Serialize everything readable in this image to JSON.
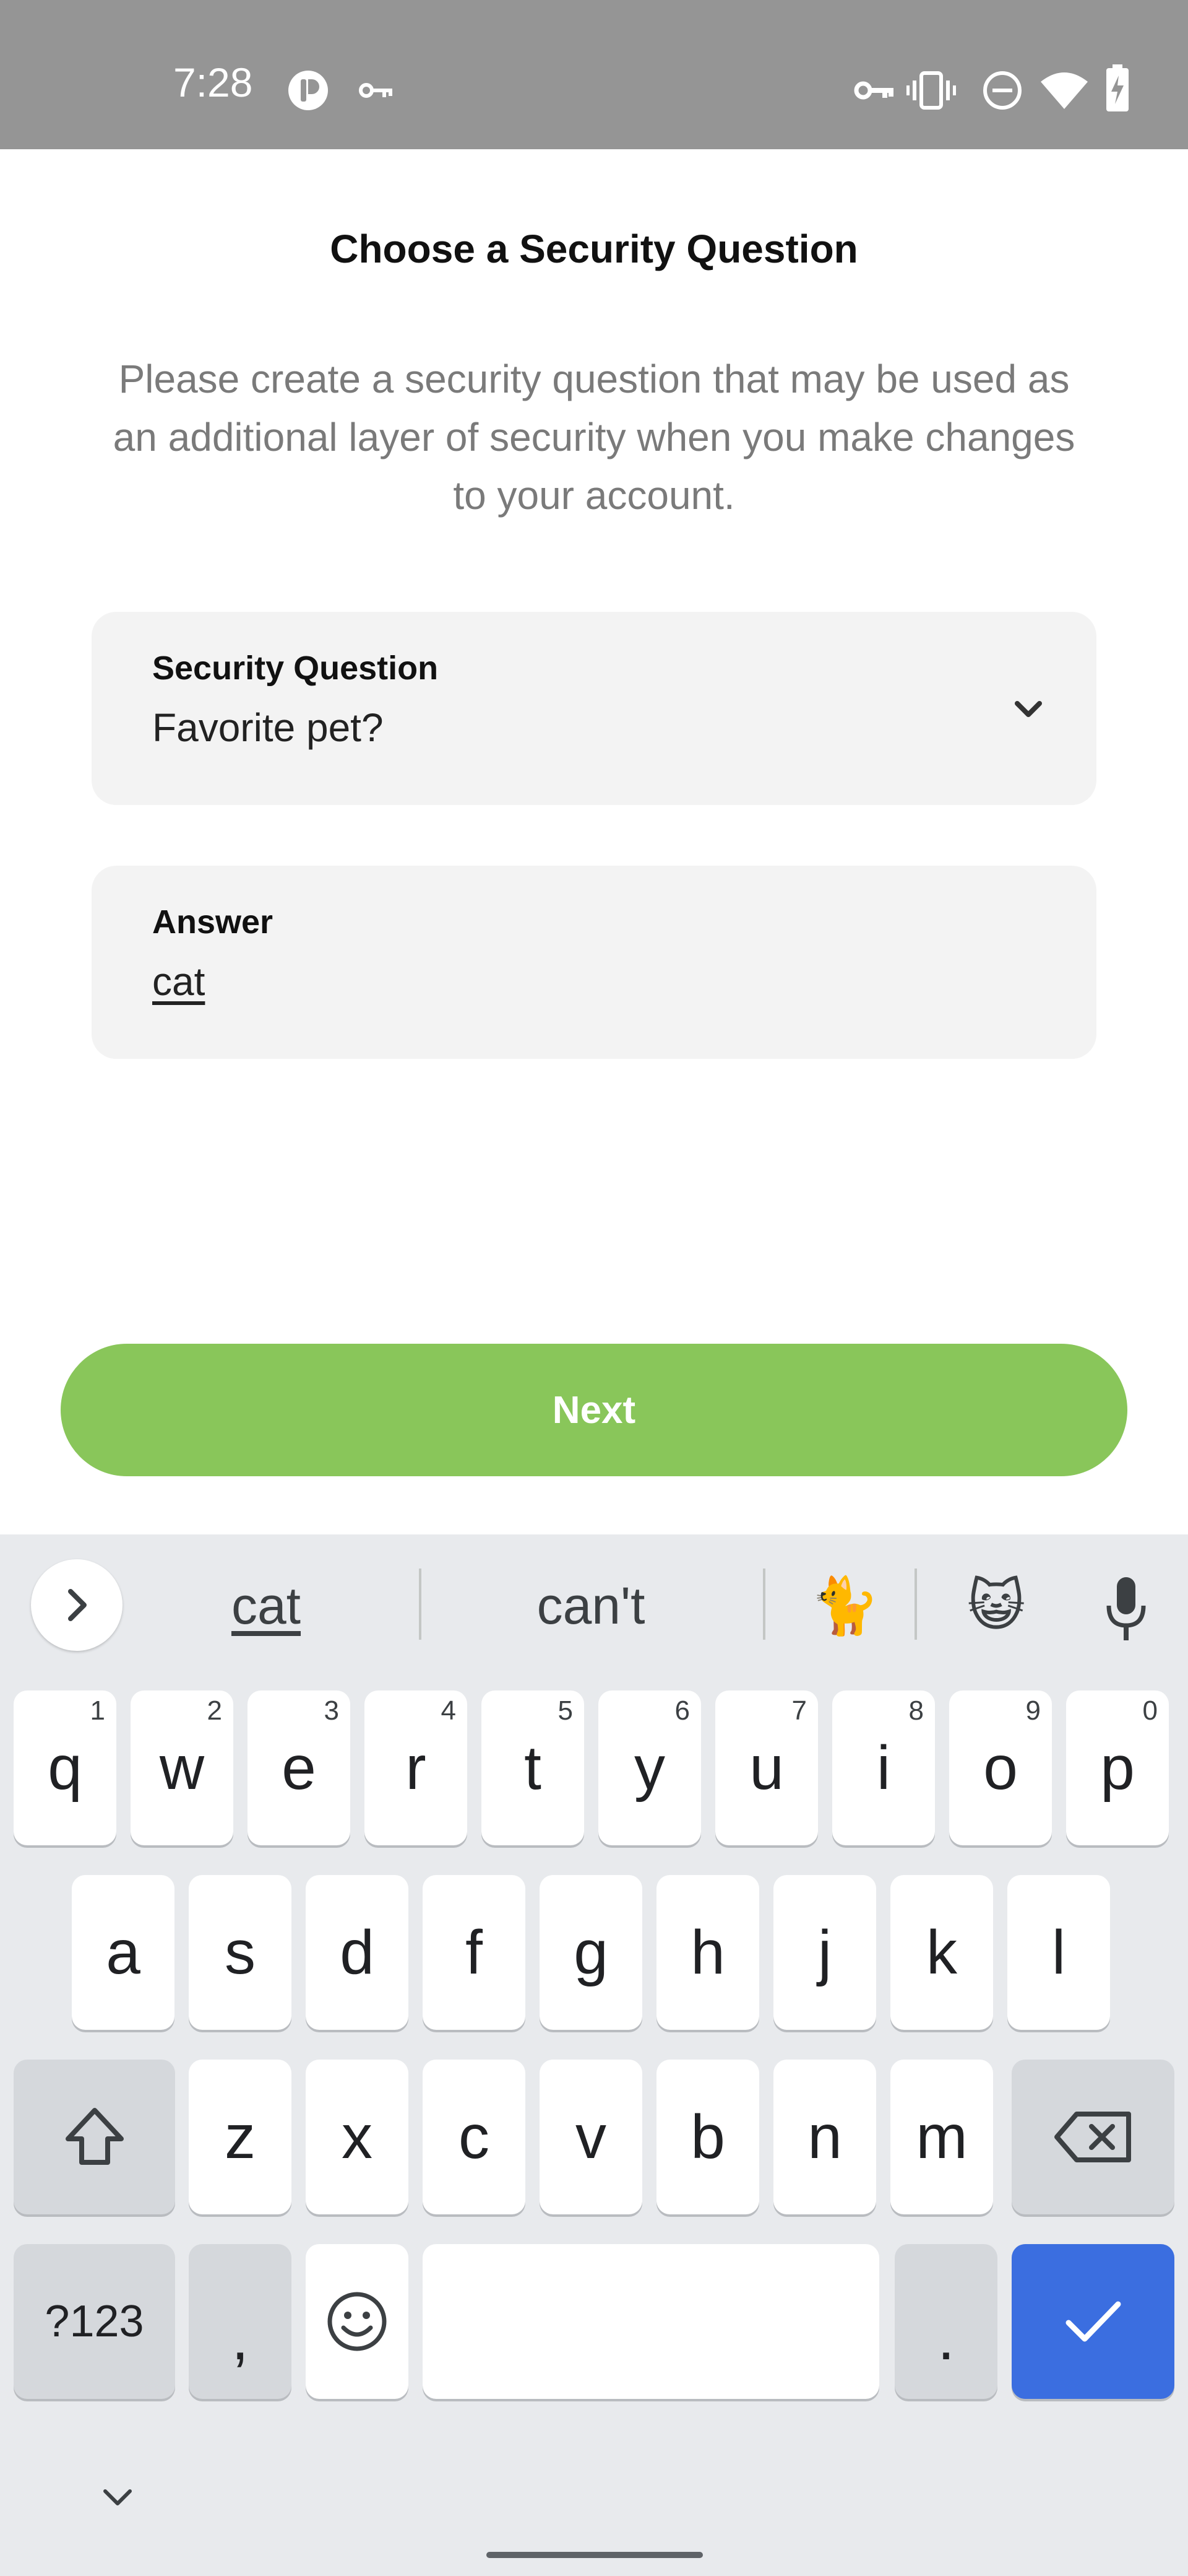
{
  "status_bar": {
    "time": "7:28"
  },
  "page": {
    "title": "Choose a Security Question",
    "description": "Please create a security question that may be used as an additional layer of security when you make changes to your account."
  },
  "security_question": {
    "label": "Security Question",
    "value": "Favorite pet?"
  },
  "answer": {
    "label": "Answer",
    "value": "cat"
  },
  "next_button": {
    "label": "Next"
  },
  "keyboard": {
    "suggestions": [
      "cat",
      "can't"
    ],
    "emoji_suggestions": [
      "🐈",
      "😺"
    ],
    "row1": [
      {
        "key": "q",
        "hint": "1"
      },
      {
        "key": "w",
        "hint": "2"
      },
      {
        "key": "e",
        "hint": "3"
      },
      {
        "key": "r",
        "hint": "4"
      },
      {
        "key": "t",
        "hint": "5"
      },
      {
        "key": "y",
        "hint": "6"
      },
      {
        "key": "u",
        "hint": "7"
      },
      {
        "key": "i",
        "hint": "8"
      },
      {
        "key": "o",
        "hint": "9"
      },
      {
        "key": "p",
        "hint": "0"
      }
    ],
    "row2": [
      "a",
      "s",
      "d",
      "f",
      "g",
      "h",
      "j",
      "k",
      "l"
    ],
    "row3": [
      "z",
      "x",
      "c",
      "v",
      "b",
      "n",
      "m"
    ],
    "symbols_label": "?123",
    "comma_label": ",",
    "period_label": "."
  },
  "colors": {
    "status_bar": "#959595",
    "accent_green": "#89c65a",
    "enter_blue": "#3b6ee0",
    "field_bg": "#f3f3f3",
    "keyboard_bg": "#e8eaed"
  }
}
